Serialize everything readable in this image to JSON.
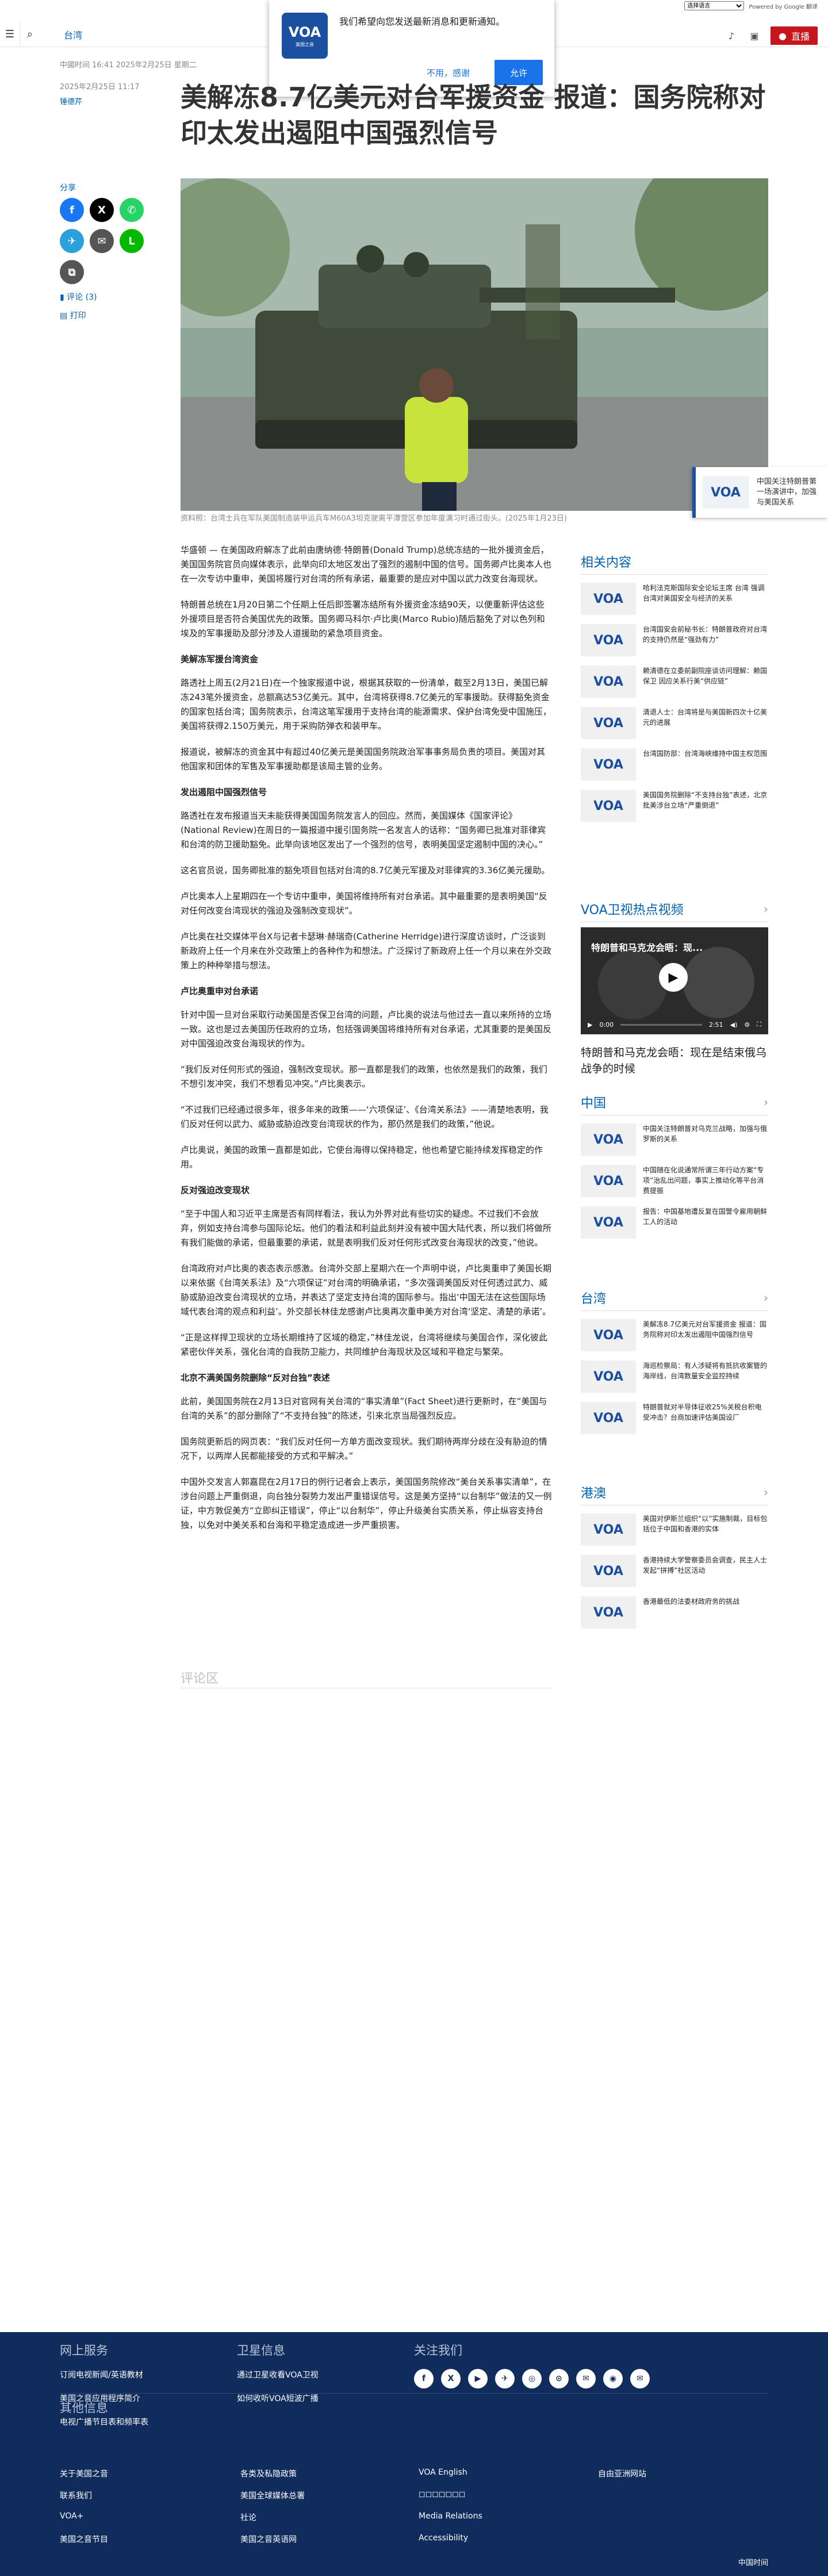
{
  "translate": {
    "select": "选择语言",
    "powered": "Powered by Google 翻译"
  },
  "nav": {
    "section": "台湾",
    "live": "直播"
  },
  "notification": {
    "logo_text": "VOA",
    "logo_sub": "美国之音",
    "message": "我们希望向您发送最新消息和更新通知。",
    "no": "不用，感谢",
    "yes": "允许"
  },
  "meta": {
    "updated": "中國时间 16:41 2025年2月25日 星期二",
    "published": "2025年2月25日 11:17",
    "author": "锤德芹"
  },
  "headline": "美解冻8.7亿美元对台军援资金  报道：国务院称对印太发出遏阻中国强烈信号",
  "share": {
    "label": "分享",
    "comments": "评论 (3)",
    "print": "打印"
  },
  "caption": "资料照：台湾士兵在军队美国制造装甲运兵车M60A3坦克驶离平潭营区参加年度演习时通过街头。(2025年1月23日)",
  "article": [
    {
      "type": "p",
      "text": "华盛顿 — 在美国政府解冻了此前由唐纳德·特朗普(Donald Trump)总统冻结的一批外援资金后，美国国务院官员向媒体表示，此举向印太地区发出了强烈的遏制中国的信号。国务卿卢比奥本人也在一次专访中重申，美国将履行对台湾的所有承诺，最重要的是应对中国以武力改变台海现状。"
    },
    {
      "type": "p",
      "text": "特朗普总统在1月20日第二个任期上任后即签署冻结所有外援资金冻结90天，以便重新评估这些外援项目是否符合美国优先的政策。国务卿马科尔·卢比奥(Marco Rubio)随后豁免了对以色列和埃及的军事援助及部分涉及人道援助的紧急项目资金。"
    },
    {
      "type": "h",
      "text": "美解冻军援台湾资金"
    },
    {
      "type": "p",
      "text": "路透社上周五(2月21日)在一个独家报道中说，根据其获取的一份清单，截至2月13日，美国已解冻243笔外援资金，总额高达53亿美元。其中，台湾将获得8.7亿美元的军事援助。获得豁免资金的国家包括台湾；国务院表示，台湾这笔军援用于支持台湾的能源需求、保护台湾免受中国施压，美国将获得2.150万美元，用于采购防弹衣和装甲车。"
    },
    {
      "type": "p",
      "text": "报道说，被解冻的资金其中有超过40亿美元是美国国务院政治军事事务局负责的项目。美国对其他国家和团体的军售及军事援助都是该局主管的业务。"
    },
    {
      "type": "h",
      "text": "发出遏阻中国强烈信号"
    },
    {
      "type": "p",
      "text": "路透社在发布报道当天未能获得美国国务院发言人的回应。然而，美国媒体《国家评论》(National Review)在周日的一篇报道中援引国务院一名发言人的话称：“国务卿已批准对菲律宾和台湾的防卫援助豁免。此举向该地区发出了一个强烈的信号，表明美国坚定遏制中国的决心。”"
    },
    {
      "type": "p",
      "text": "这名官员说，国务卿批准的豁免项目包括对台湾的8.7亿美元军援及对菲律宾的3.36亿美元援助。"
    },
    {
      "type": "p",
      "text": "卢比奥本人上星期四在一个专访中重申，美国将维持所有对台承诺。其中最重要的是表明美国“反对任何改变台湾现状的强迫及强制改变现状”。"
    },
    {
      "type": "p",
      "text": "卢比奥在社交媒体平台X与记者卡瑟琳·赫瑞奇(Catherine Herridge)进行深度访谈时，广泛谈到新政府上任一个月来在外交政策上的各种作为和想法。广泛探讨了新政府上任一个月以来在外交政策上的种种举措与想法。"
    },
    {
      "type": "h",
      "text": "卢比奥重申对台承诺"
    },
    {
      "type": "p",
      "text": "针对中国一旦对台采取行动美国是否保卫台湾的问题，卢比奥的说法与他过去一直以来所持的立场一致。这也是过去美国历任政府的立场，包括强调美国将维持所有对台承诺，尤其重要的是美国反对中国强迫改变台海现状的作为。"
    },
    {
      "type": "p",
      "text": "“我们反对任何形式的强迫，强制改变现状。那一直都是我们的政策，也依然是我们的政策，我们不想引发冲突，我们不想看见冲突。”卢比奥表示。"
    },
    {
      "type": "p",
      "text": "“不过我们已经通过很多年，很多年来的政策——‘六项保证’、《台湾关系法》——清楚地表明，我们反对任何以武力、威胁或胁迫改变台湾现状的作为，那仍然是我们的政策，”他说。"
    },
    {
      "type": "p",
      "text": "卢比奥说，美国的政策一直都是如此，它使台海得以保持稳定，他也希望它能持续发挥稳定的作用。"
    },
    {
      "type": "h",
      "text": "反对强迫改变现状"
    },
    {
      "type": "p",
      "text": "“至于中国人和习近平主席是否有同样看法，我认为外界对此有些切实的疑虑。不过我们不会放弃，例如支持台湾参与国际论坛。他们的看法和利益此刻并没有被中国大陆代表，所以我们将做所有我们能做的承诺，但最重要的承诺，就是表明我们反对任何形式改变台海现状的改变，”他说。"
    },
    {
      "type": "p",
      "text": "台湾政府对卢比奥的表态表示感激。台湾外交部上星期六在一个声明中说，卢比奥重申了美国长期以来依据《台湾关系法》及“六项保证”对台湾的明确承诺，“多次强调美国反对任何透过武力、威胁或胁迫改变台湾现状的立场，并表达了坚定支持台湾的国际参与。指出‘中国无法在这些国际场域代表台湾的观点和利益’。外交部长林佳龙感谢卢比奥再次重申美方对台湾‘坚定、清楚的承诺’。"
    },
    {
      "type": "p",
      "text": "“正是这样捍卫现状的立场长期维持了区域的稳定，”林佳龙说，台湾将继续与美国合作，深化彼此紧密伙伴关系，强化台湾的自我防卫能力，共同维护台海现状及区域和平稳定与繁荣。"
    },
    {
      "type": "h",
      "text": "北京不满美国务院删除“反对台独”表述"
    },
    {
      "type": "p",
      "text": "此前，美国国务院在2月13日对官网有关台湾的“事实清单”(Fact Sheet)进行更新时，在“美国与台湾的关系”的部分删除了“不支持台独”的陈述，引来北京当局强烈反应。"
    },
    {
      "type": "p",
      "text": "国务院更新后的网页表：“我们反对任何一方单方面改变现状。我们期待两岸分歧在没有胁迫的情况下，以两岸人民都能接受的方式和平解决。”"
    },
    {
      "type": "p",
      "text": "中国外交发言人郭嘉昆在2月17日的例行记者会上表示，美国国务院修改“美台关系事实清单”，在涉台问题上严重倒退，向台独分裂势力发出严重错误信号。这是美方坚持“以台制华”做法的又一例证，中方敦促美方“立即纠正错误”，停止“以台制华”，停止升级美台实质关系，停止纵容支持台独，以免对中美关系和台海和平稳定造成进一步严重损害。"
    }
  ],
  "comments_heading": "评论区",
  "promo": {
    "logo": "VOA",
    "text": "中国关注特朗普第一场演讲中，加强与美国关系"
  },
  "related": {
    "heading": "相关内容",
    "items": [
      {
        "logo": "VOA",
        "text": "哈利法克斯国际安全论坛主席 台湾 强调台湾对美国安全与经济的关系"
      },
      {
        "logo": "VOA",
        "text": "台湾国安会前秘书长：特朗普政府对台湾的支持仍然是“强劲有力”"
      },
      {
        "logo": "VOA",
        "text": "赖清德在立委前副院座谈访问理解：赖国保卫 因应关系行美“供应链”"
      },
      {
        "logo": "VOA",
        "text": "清退人士：台湾将是与美国新四次十亿美元的进展"
      },
      {
        "logo": "VOA",
        "text": "台湾国防部：台湾海峡维持中国主权范围"
      },
      {
        "logo": "VOA",
        "text": "美国国务院删除“不支持台独”表述，北京批美涉台立场“严重倒退”"
      }
    ]
  },
  "video": {
    "heading": "VOA卫视热点视频",
    "title": "特朗普和马克龙会晤：现在是结束俄乌战争的时候",
    "player_title": "特朗普和马克龙会晤：现...",
    "time_current": "0:00",
    "time_total": "2:51"
  },
  "china": {
    "heading": "中国",
    "items": [
      {
        "logo": "VOA",
        "text": "中国关注特朗普对乌克兰战略，加强与俄罗斯的关系"
      },
      {
        "logo": "VOA",
        "text": "中国随在化说通常所谓三年行动方案“专项”治乱出问题，事实上推动化等平台消费提振"
      },
      {
        "logo": "VOA",
        "text": "报告：中国基地遭反复在国警令雇用朝鲜工人的活动"
      }
    ]
  },
  "taiwan": {
    "heading": "台湾",
    "items": [
      {
        "logo": "VOA",
        "text": "美解冻8.7亿美元对台军援资金 报道：国务院称对印太发出遏阻中国强烈信号"
      },
      {
        "logo": "VOA",
        "text": "海巡检察局：有人涉疑将有抵抗收案管的海岸线，台湾数量安全监控持续"
      },
      {
        "logo": "VOA",
        "text": "特朗普就对半导体征收25%关税台积电受冲击？台商加速评估美国设厂"
      }
    ]
  },
  "hongkong": {
    "heading": "港澳",
    "items": [
      {
        "logo": "VOA",
        "text": "美国对伊斯兰组织“以”实施制裁，目标包括位于中国和香港的实体"
      },
      {
        "logo": "VOA",
        "text": "香港持续大学警察委员会调查，民主人士发起“拼搏”社区活动"
      },
      {
        "logo": "VOA",
        "text": "香港最低的法委材政府务的挑战"
      }
    ]
  },
  "footer": {
    "col1": {
      "heading": "网上服务",
      "links": [
        "订阅电视新闻/英语教材",
        "美国之音应用程序简介",
        "电视广播节目表和频率表"
      ]
    },
    "col2": {
      "heading": "卫星信息",
      "links": [
        "通过卫星收看VOA卫视",
        "如何收听VOA短波广播"
      ]
    },
    "col3": {
      "heading": "关注我们",
      "social": [
        "f",
        "X",
        "▶",
        "✈",
        "◎",
        "⊙",
        "✉",
        "◉",
        "✉"
      ]
    },
    "other_heading": "其他信息",
    "other_links": [
      [
        "关于美国之音",
        "各类及私隐政策",
        "VOA English",
        "自由亚洲网站"
      ],
      [
        "联系我们",
        "美国全球媒体总署",
        "◻◻◻◻◻◻◻",
        ""
      ],
      [
        "VOA+",
        "社论",
        "Media Relations",
        ""
      ],
      [
        "美国之音节目",
        "美国之音英语网",
        "Accessibility",
        ""
      ]
    ],
    "copyright": "中国时间"
  }
}
